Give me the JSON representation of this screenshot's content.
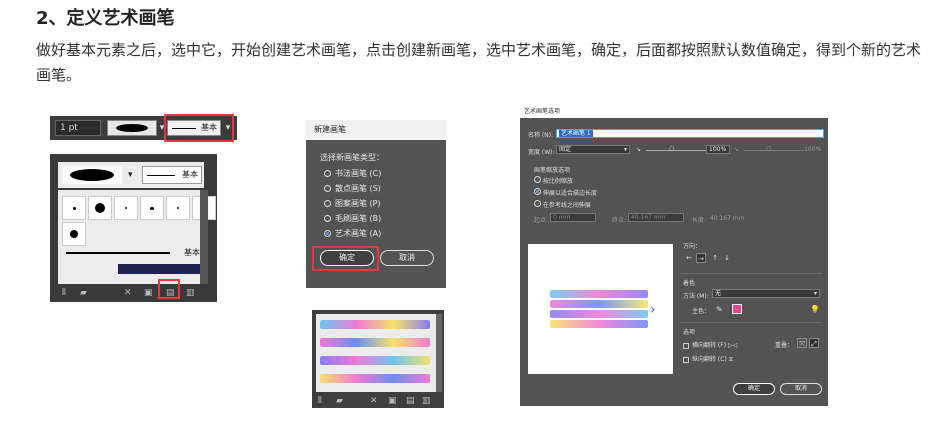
{
  "heading": "2、定义艺术画笔",
  "paragraph": "做好基本元素之后，选中它，开始创建艺术画笔，点击创建新画笔，选中艺术画笔，确定，后面都按照默认数值确定，得到个新的艺术画笔。",
  "panel1": {
    "stroke_value": "1 pt",
    "brush_label": "基本",
    "list_line_label": "基本"
  },
  "new_brush_dialog": {
    "title": "新建画笔",
    "prompt": "选择新画笔类型：",
    "options": [
      {
        "label": "书法画笔 (C)",
        "selected": false
      },
      {
        "label": "散点画笔 (S)",
        "selected": false
      },
      {
        "label": "图案画笔 (P)",
        "selected": false
      },
      {
        "label": "毛刷画笔 (B)",
        "selected": false
      },
      {
        "label": "艺术画笔 (A)",
        "selected": true
      }
    ],
    "ok": "确定",
    "cancel": "取消"
  },
  "art_brush_options": {
    "caption": "艺术画笔选项",
    "name_label": "名称 (N):",
    "name_value": "艺术画笔 1",
    "width_label": "宽度 (W):",
    "width_mode": "固定",
    "width_value": "100%",
    "width_value2": "100%",
    "scale_section": "画笔缩放选项",
    "scale_options": [
      {
        "label": "按比例缩放",
        "selected": false
      },
      {
        "label": "伸展以适合描边长度",
        "selected": true
      },
      {
        "label": "在参考线之间伸展",
        "selected": false
      }
    ],
    "start_label": "起点:",
    "start_value": "0 mm",
    "end_label": "终点:",
    "end_value": "40.167 mm",
    "length_label": "长度:",
    "length_value": "40.167 mm",
    "direction_label": "方向：",
    "colorize_label": "着色",
    "method_label": "方法 (M):",
    "method_value": "无",
    "key_color_label": "主色：",
    "options_label": "选项",
    "flip_along": "横向翻转 (F)",
    "flip_across": "纵向翻转 (C)",
    "overlap_label": "重叠：",
    "ok": "确定",
    "cancel": "取消",
    "key_color": "#e8459a"
  }
}
